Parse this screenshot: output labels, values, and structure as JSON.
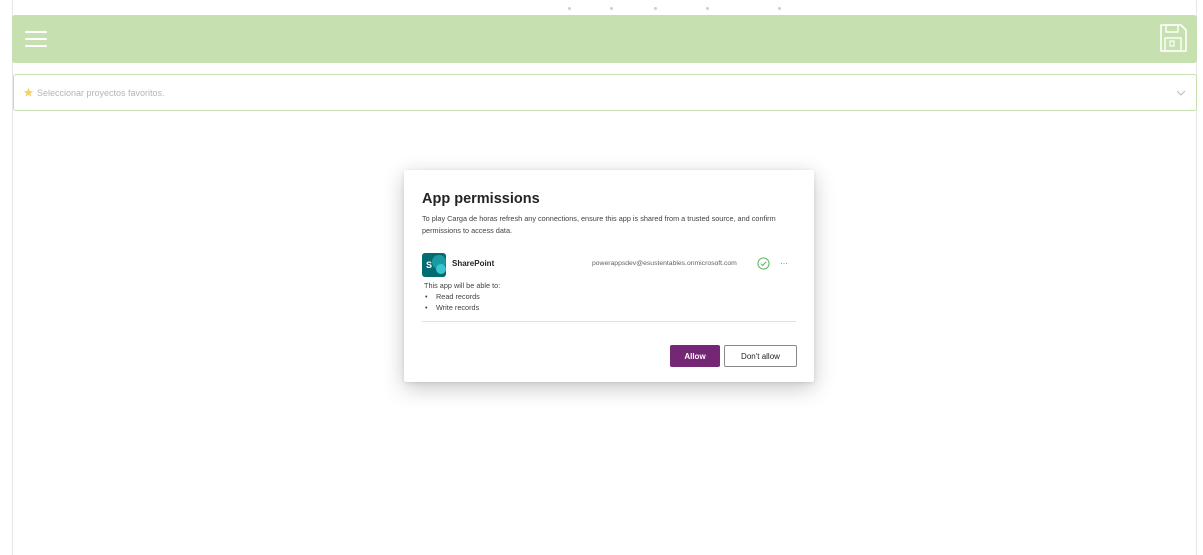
{
  "app": {
    "favorites_placeholder": "Seleccionar proyectos favoritos.",
    "header_color": "#c6e0b0",
    "icons": {
      "menu": "hamburger-icon",
      "save": "floppy-disk-icon",
      "favorite": "star-icon",
      "dropdown": "chevron-down-icon"
    }
  },
  "dialog": {
    "title": "App permissions",
    "description": "To play Carga de horas refresh any connections, ensure this app is shared from a trusted source, and confirm permissions to access data.",
    "connection": {
      "name": "SharePoint",
      "logo_letter": "S",
      "account": "powerappsdev@esustentables.onmicrosoft.com",
      "more": "···",
      "status_icon": "check-circle-icon",
      "status_color": "#4caf50"
    },
    "able_to": "This app will be able to:",
    "permissions": [
      "Read records",
      "Write records"
    ],
    "allow_label": "Allow",
    "deny_label": "Don't allow",
    "accent_color": "#742774"
  }
}
